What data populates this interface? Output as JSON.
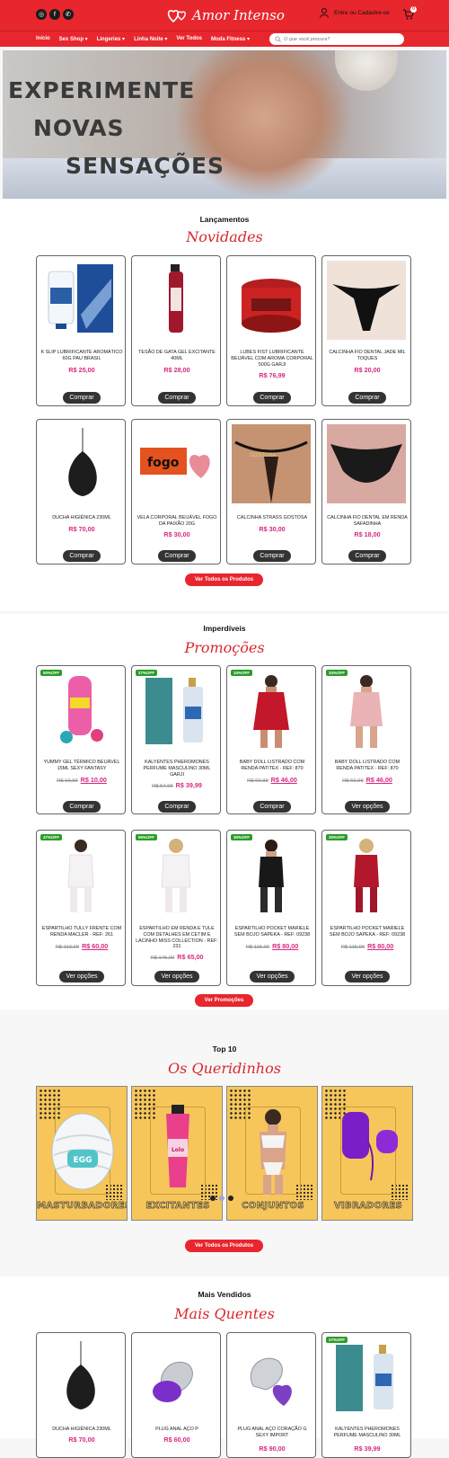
{
  "header": {
    "social_icons": [
      "instagram-icon",
      "facebook-icon",
      "whatsapp-icon"
    ],
    "logo_text": "Amor Intenso",
    "account_label": "Entre ou Cadastre-se",
    "cart_count": "0"
  },
  "nav": {
    "items": [
      "Início",
      "Sex Shop ▾",
      "Lingeries ▾",
      "Linha Noite ▾",
      "Ver Todos",
      "Moda Fitness ▾"
    ],
    "search_placeholder": "O que você procura?"
  },
  "hero": {
    "line1": "EXPERIMENTE",
    "line2": "NOVAS",
    "line3": "SENSAÇÕES"
  },
  "novidades": {
    "title": "Lançamentos",
    "script": "Novidades",
    "products": [
      {
        "name": "K SLIP LUBRIFICANTE AROMÁTICO 60G PAU BRASIL",
        "price": "R$ 25,00",
        "button": "Comprar"
      },
      {
        "name": "TESÃO DE GATA GEL EXCITANTE 40ML",
        "price": "R$ 28,00",
        "button": "Comprar"
      },
      {
        "name": "LUBES FIST LUBRIFICANTE BEIJÁVEL COM AROMA CORPORAL 500G GARJI",
        "price": "R$ 76,99",
        "button": "Comprar"
      },
      {
        "name": "CALCINHA FIO DENTAL JADE MIL TOQUES",
        "price": "R$ 20,00",
        "button": "Comprar"
      },
      {
        "name": "DUCHA HIGIÊNICA 230ML",
        "price": "R$ 70,00",
        "button": "Comprar"
      },
      {
        "name": "VELA CORPORAL BEIJÁVEL FOGO DA PAIXÃO 20G",
        "price": "R$ 30,00",
        "button": "Comprar"
      },
      {
        "name": "CALCINHA STRASS GOSTOSA",
        "price": "R$ 30,00",
        "button": "Comprar"
      },
      {
        "name": "CALCINHA FIO DENTAL EM RENDA SAFADINHA",
        "price": "R$ 18,00",
        "button": "Comprar"
      }
    ],
    "cta": "Ver Todos os Produtos"
  },
  "promocoes": {
    "title": "Imperdíveis",
    "script": "Promoções",
    "products": [
      {
        "badge": "50%OFF",
        "name": "YUMMY GEL TÉRMICO BEIJÁVEL 15ML SEXY FANTASY",
        "old": "R$ 19,99",
        "price": "R$ 10,00",
        "button": "Comprar"
      },
      {
        "badge": "27%OFF",
        "name": "KALYENTES PHEROMONES PERFUME MASCULINO 30ML GARJI",
        "old": "R$ 54,99",
        "price": "R$ 39,99",
        "button": "Comprar"
      },
      {
        "badge": "34%OFF",
        "name": "BABY DOLL LISTRADO COM RENDA PATITEX - REF: 870",
        "old": "R$ 69,99",
        "price": "R$ 46,00",
        "button": "Comprar"
      },
      {
        "badge": "34%OFF",
        "name": "BABY DOLL LISTRADO COM RENDA PATITEX - REF: 870",
        "old": "R$ 69,99",
        "price": "R$ 46,00",
        "button": "Ver opções"
      },
      {
        "badge": "47%OFF",
        "name": "ESPARTILHO TULLY FRENTE COM RENDA MACLER - REF: 261",
        "old": "R$ 113,99",
        "price": "R$ 60,00",
        "button": "Ver opções"
      },
      {
        "badge": "55%OFF",
        "name": "ESPARTILHO EM RENDA E TULE COM DETALHES EM CETIM E LACINHO MISS COLLECTION - REF: 231",
        "old": "R$ 145,00",
        "price": "R$ 65,00",
        "button": "Ver opções"
      },
      {
        "badge": "30%OFF",
        "name": "ESPARTILHO POCKET MARIELE SEM BOJO SAPEKA - REF: 09238",
        "old": "R$ 115,00",
        "price": "R$ 80,00",
        "button": "Ver opções"
      },
      {
        "badge": "30%OFF",
        "name": "ESPARTILHO POCKET MARIELE SEM BOJO SAPEKA - REF: 09238",
        "old": "R$ 115,00",
        "price": "R$ 80,00",
        "button": "Ver opções"
      }
    ],
    "cta": "Ver Promoções"
  },
  "top10": {
    "title": "Top 10",
    "script": "Os Queridinhos",
    "categories": [
      "MASTURBADORES",
      "EXCITANTES",
      "CONJUNTOS",
      "VIBRADORES"
    ],
    "cta": "Ver Todos os Produtos",
    "carousel_pages": 3,
    "active_page": 2
  },
  "mais_vendidos": {
    "title": "Mais Vendidos",
    "script": "Mais Quentes",
    "products": [
      {
        "badge": "",
        "name": "DUCHA HIGIÊNICA 230ML",
        "price": "R$ 70,00"
      },
      {
        "badge": "",
        "name": "PLUG ANAL AÇO P",
        "price": "R$ 60,00"
      },
      {
        "badge": "",
        "name": "PLUG ANAL AÇO CORAÇÃO G SEXY IMPORT",
        "price": "R$ 90,00"
      },
      {
        "badge": "27%OFF",
        "name": "KALYENTES PHEROMONES PERFUME MASCULINO 30ML",
        "price": "R$ 39,99"
      }
    ]
  }
}
